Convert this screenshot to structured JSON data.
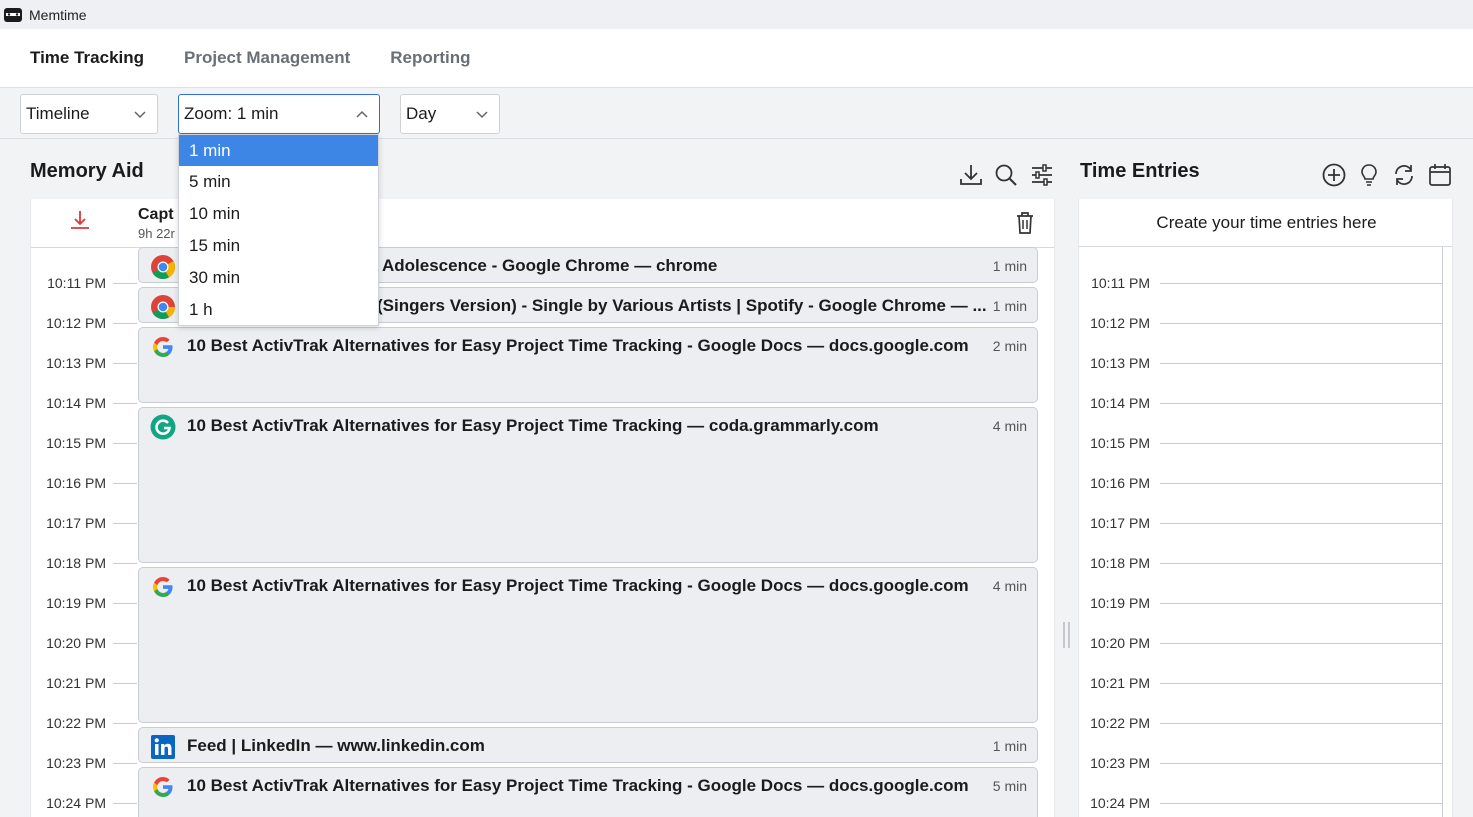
{
  "app": {
    "title": "Memtime"
  },
  "nav": {
    "tabs": [
      {
        "label": "Time Tracking"
      },
      {
        "label": "Project Management"
      },
      {
        "label": "Reporting"
      }
    ]
  },
  "toolbar": {
    "view_select": "Timeline",
    "zoom_select": "Zoom: 1 min",
    "period_select": "Day"
  },
  "zoom_options": [
    {
      "label": "1 min",
      "selected": true
    },
    {
      "label": "5 min"
    },
    {
      "label": "10 min"
    },
    {
      "label": "15 min"
    },
    {
      "label": "30 min"
    },
    {
      "label": "1 h"
    }
  ],
  "memory_aid": {
    "title": "Memory Aid",
    "header_title": "Capt",
    "header_sub": "9h 22r",
    "times": [
      "10:11 PM",
      "10:12 PM",
      "10:13 PM",
      "10:14 PM",
      "10:15 PM",
      "10:16 PM",
      "10:17 PM",
      "10:18 PM",
      "10:19 PM",
      "10:20 PM",
      "10:21 PM",
      "10:22 PM",
      "10:23 PM",
      "10:24 PM"
    ],
    "entries": [
      {
        "icon": "chrome-icon",
        "text": "Adolescence - Google Chrome — chrome",
        "duration": "1 min"
      },
      {
        "icon": "chrome-icon",
        "text": "(Singers Version) - Single by Various Artists | Spotify - Google Chrome — ...",
        "duration": "1 min"
      },
      {
        "icon": "google-icon",
        "text": "10 Best ActivTrak Alternatives for Easy Project Time Tracking - Google Docs — docs.google.com",
        "duration": "2 min"
      },
      {
        "icon": "grammarly-icon",
        "text": "10 Best ActivTrak Alternatives for Easy Project Time Tracking — coda.grammarly.com",
        "duration": "4 min"
      },
      {
        "icon": "google-icon",
        "text": "10 Best ActivTrak Alternatives for Easy Project Time Tracking - Google Docs — docs.google.com",
        "duration": "4 min"
      },
      {
        "icon": "linkedin-icon",
        "text": "Feed | LinkedIn — www.linkedin.com",
        "duration": "1 min"
      },
      {
        "icon": "google-icon",
        "text": "10 Best ActivTrak Alternatives for Easy Project Time Tracking - Google Docs — docs.google.com",
        "duration": "5 min"
      }
    ]
  },
  "time_entries": {
    "title": "Time Entries",
    "header": "Create your time entries here",
    "times": [
      "10:11 PM",
      "10:12 PM",
      "10:13 PM",
      "10:14 PM",
      "10:15 PM",
      "10:16 PM",
      "10:17 PM",
      "10:18 PM",
      "10:19 PM",
      "10:20 PM",
      "10:21 PM",
      "10:22 PM",
      "10:23 PM",
      "10:24 PM"
    ]
  },
  "colors": {
    "accent": "#3d86e6",
    "chrome_red": "#db4437",
    "google_blue": "#4285f4",
    "grammarly_green": "#15c39a",
    "linkedin_blue": "#0a66c2",
    "download_red": "#d9363e"
  }
}
